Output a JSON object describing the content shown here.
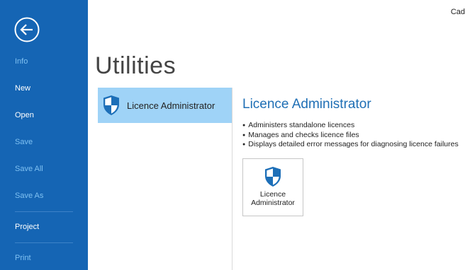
{
  "header": {
    "corner_text": "Cad"
  },
  "sidebar": {
    "back_icon": "back-arrow-icon",
    "items": [
      {
        "label": "Info"
      },
      {
        "label": "New"
      },
      {
        "label": "Open"
      },
      {
        "label": "Save"
      },
      {
        "label": "Save All"
      },
      {
        "label": "Save As"
      },
      {
        "label": "Project"
      },
      {
        "label": "Print"
      }
    ]
  },
  "main": {
    "title": "Utilities",
    "list": [
      {
        "label": "Licence Administrator",
        "icon": "shield-icon",
        "selected": true
      }
    ],
    "detail": {
      "title": "Licence Administrator",
      "bullets": [
        "Administers standalone licences",
        "Manages and checks licence files",
        "Displays detailed error messages for diagnosing licence failures"
      ],
      "button": {
        "line1": "Licence",
        "line2": "Administrator",
        "icon": "shield-icon"
      }
    }
  },
  "colors": {
    "sidebar_bg": "#1565b4",
    "accent": "#1f6fb5",
    "selected_bg": "#9fd3f7",
    "shield_blue": "#1d6fb8"
  }
}
